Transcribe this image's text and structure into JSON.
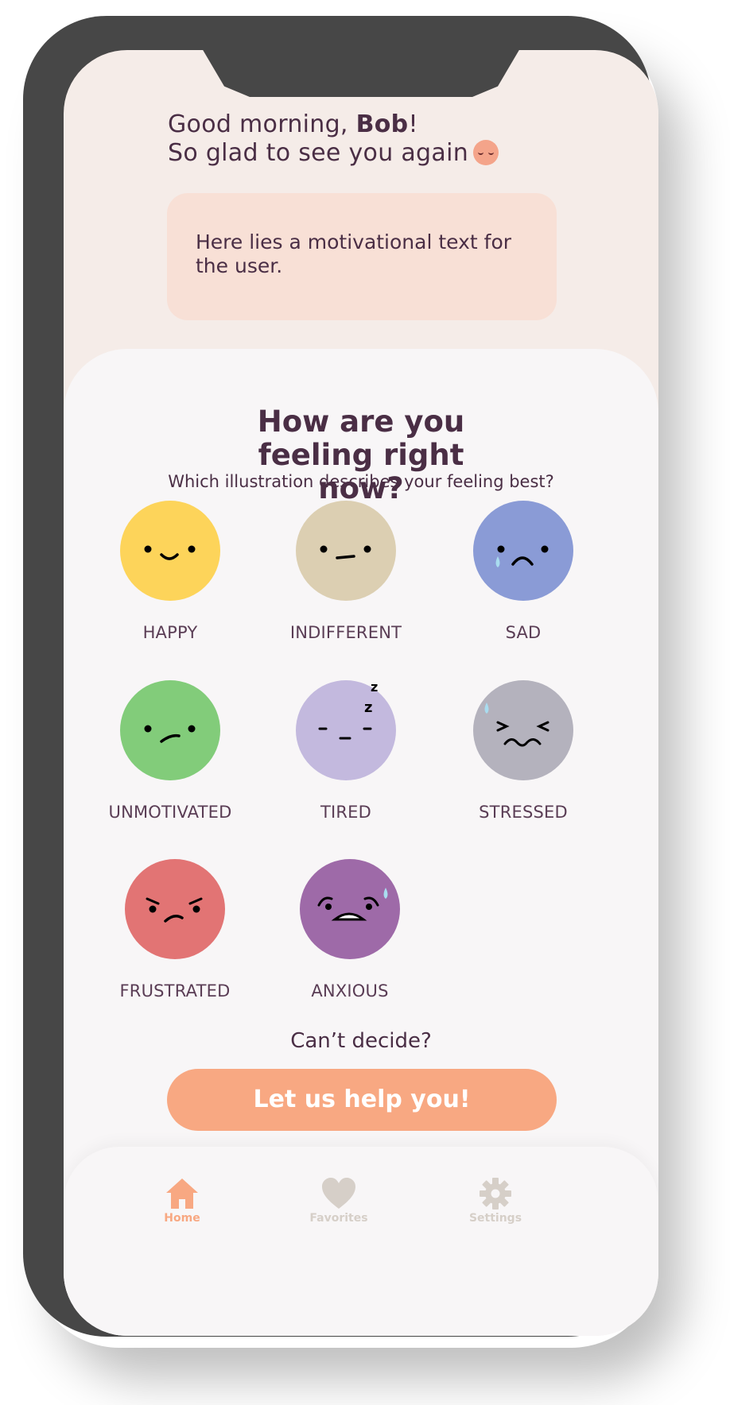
{
  "header": {
    "greeting_prefix": "Good morning,",
    "user_name": "Bob",
    "greeting_suffix": "!",
    "subtitle": "So glad to see you again"
  },
  "motivation": {
    "text": "Here lies a motivational text for the user."
  },
  "question": {
    "title": "How are you feeling right now?",
    "subtitle": "Which illustration describes your feeling best?"
  },
  "moods": [
    {
      "label": "HAPPY",
      "color": "#fdd45a",
      "icon": "happy-face-icon"
    },
    {
      "label": "INDIFFERENT",
      "color": "#dccfb2",
      "icon": "indifferent-face-icon"
    },
    {
      "label": "SAD",
      "color": "#8a9bd6",
      "icon": "sad-face-icon"
    },
    {
      "label": "UNMOTIVATED",
      "color": "#82cc7a",
      "icon": "unmotivated-face-icon"
    },
    {
      "label": "TIRED",
      "color": "#c3b9de",
      "icon": "tired-face-icon"
    },
    {
      "label": "STRESSED",
      "color": "#b4b2bd",
      "icon": "stressed-face-icon"
    },
    {
      "label": "FRUSTRATED",
      "color": "#e27474",
      "icon": "frustrated-face-icon"
    },
    {
      "label": "ANXIOUS",
      "color": "#9e6aa8",
      "icon": "anxious-face-icon"
    }
  ],
  "help": {
    "prompt": "Can’t decide?",
    "button_label": "Let us help you!"
  },
  "tabbar": {
    "items": [
      {
        "label": "Home",
        "icon": "home-icon",
        "active": true
      },
      {
        "label": "Favorites",
        "icon": "heart-icon",
        "active": false
      },
      {
        "label": "Settings",
        "icon": "gear-icon",
        "active": false
      }
    ]
  },
  "colors": {
    "accent": "#f8a882",
    "text": "#4a2e45",
    "inactive": "#d6cfc8",
    "motivation_bg": "#f8e0d6",
    "background": "#f5ece8"
  }
}
